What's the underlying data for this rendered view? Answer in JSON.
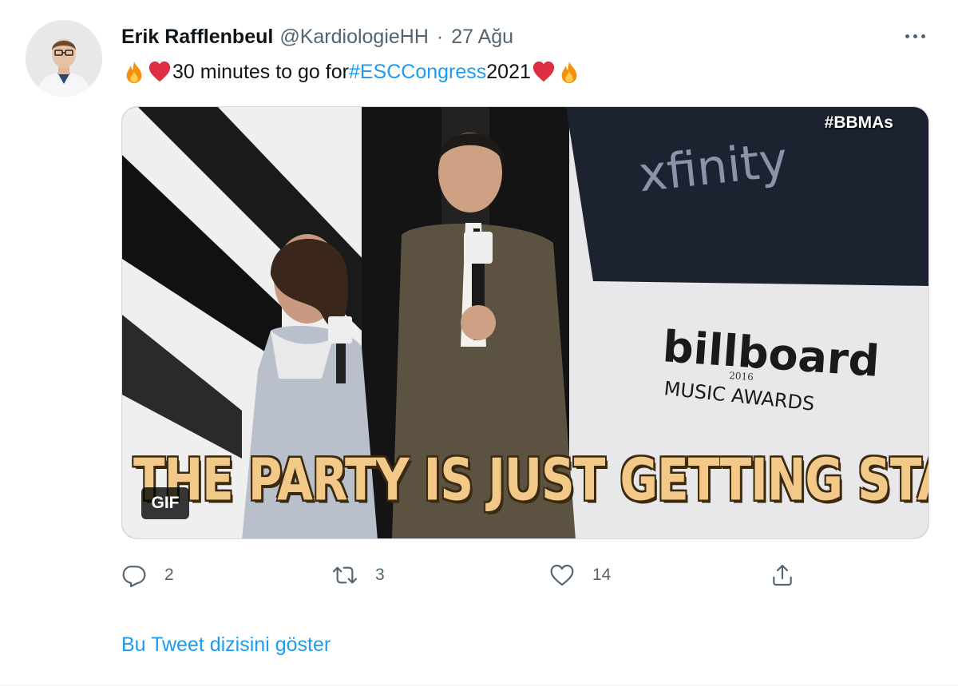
{
  "author": {
    "display_name": "Erik Rafflenbeul",
    "handle": "@KardiologieHH",
    "separator": "·",
    "date": "27 Ağu"
  },
  "tweet": {
    "text_main": "30 minutes to go for ",
    "hashtag": "#ESCCongress",
    "text_after": " 2021",
    "emoji_lead": [
      "fire-emoji",
      "red-heart-emoji"
    ],
    "emoji_trail": [
      "red-heart-emoji",
      "fire-emoji"
    ]
  },
  "media": {
    "type": "GIF",
    "badge": "GIF",
    "overlay_hashtag": "#BBMAs",
    "caption": "THE PARTY IS JUST GETTING STARTED",
    "sign_xfinity": "xfinity",
    "sign_billboard": "billboard",
    "sign_year": "2016",
    "sign_awards": "MUSIC AWARDS"
  },
  "actions": {
    "reply_count": "2",
    "retweet_count": "3",
    "like_count": "14"
  },
  "show_thread": "Bu Tweet dizisini göster",
  "colors": {
    "accent": "#1d9bf0",
    "secondary_text": "#536471",
    "primary_text": "#0f1419",
    "border": "#cfd9de"
  },
  "icons": [
    "more-icon",
    "reply-icon",
    "retweet-icon",
    "like-icon",
    "share-icon"
  ]
}
